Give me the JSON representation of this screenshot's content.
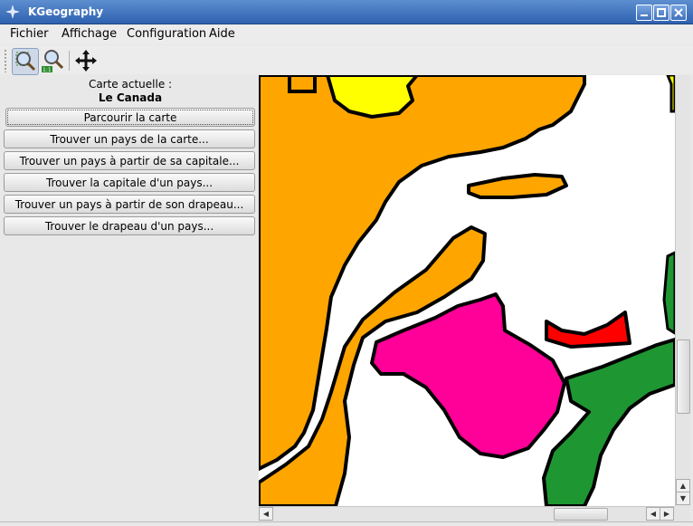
{
  "window": {
    "title": "KGeography"
  },
  "menu": [
    {
      "label": "Fichier"
    },
    {
      "label": "Affichage"
    },
    {
      "label": "Configuration"
    },
    {
      "label": "Aide"
    }
  ],
  "toolbar": {
    "tools": [
      {
        "icon": "zoom-select-icon",
        "active": true
      },
      {
        "icon": "zoom-original-icon",
        "active": false
      },
      {
        "icon": "move-icon",
        "active": false
      }
    ]
  },
  "sidebar": {
    "current_map_label": "Carte actuelle :",
    "current_map_name": "Le Canada",
    "actions": [
      {
        "label": "Parcourir la carte"
      },
      {
        "label": "Trouver un pays de la carte..."
      },
      {
        "label": "Trouver un pays à partir de sa capitale..."
      },
      {
        "label": "Trouver la capitale d'un pays..."
      },
      {
        "label": "Trouver un pays à partir de son drapeau..."
      },
      {
        "label": "Trouver le drapeau d'un pays..."
      }
    ]
  },
  "map": {
    "colors": {
      "orange": "#ffa500",
      "yellow": "#ffff00",
      "magenta": "#ff00a0",
      "green": "#1e9632",
      "red": "#ff0000",
      "water": "#ffffff",
      "border": "#000000"
    }
  },
  "scrollbars": {
    "vertical_position": 0.62,
    "horizontal_position": 0.74
  }
}
